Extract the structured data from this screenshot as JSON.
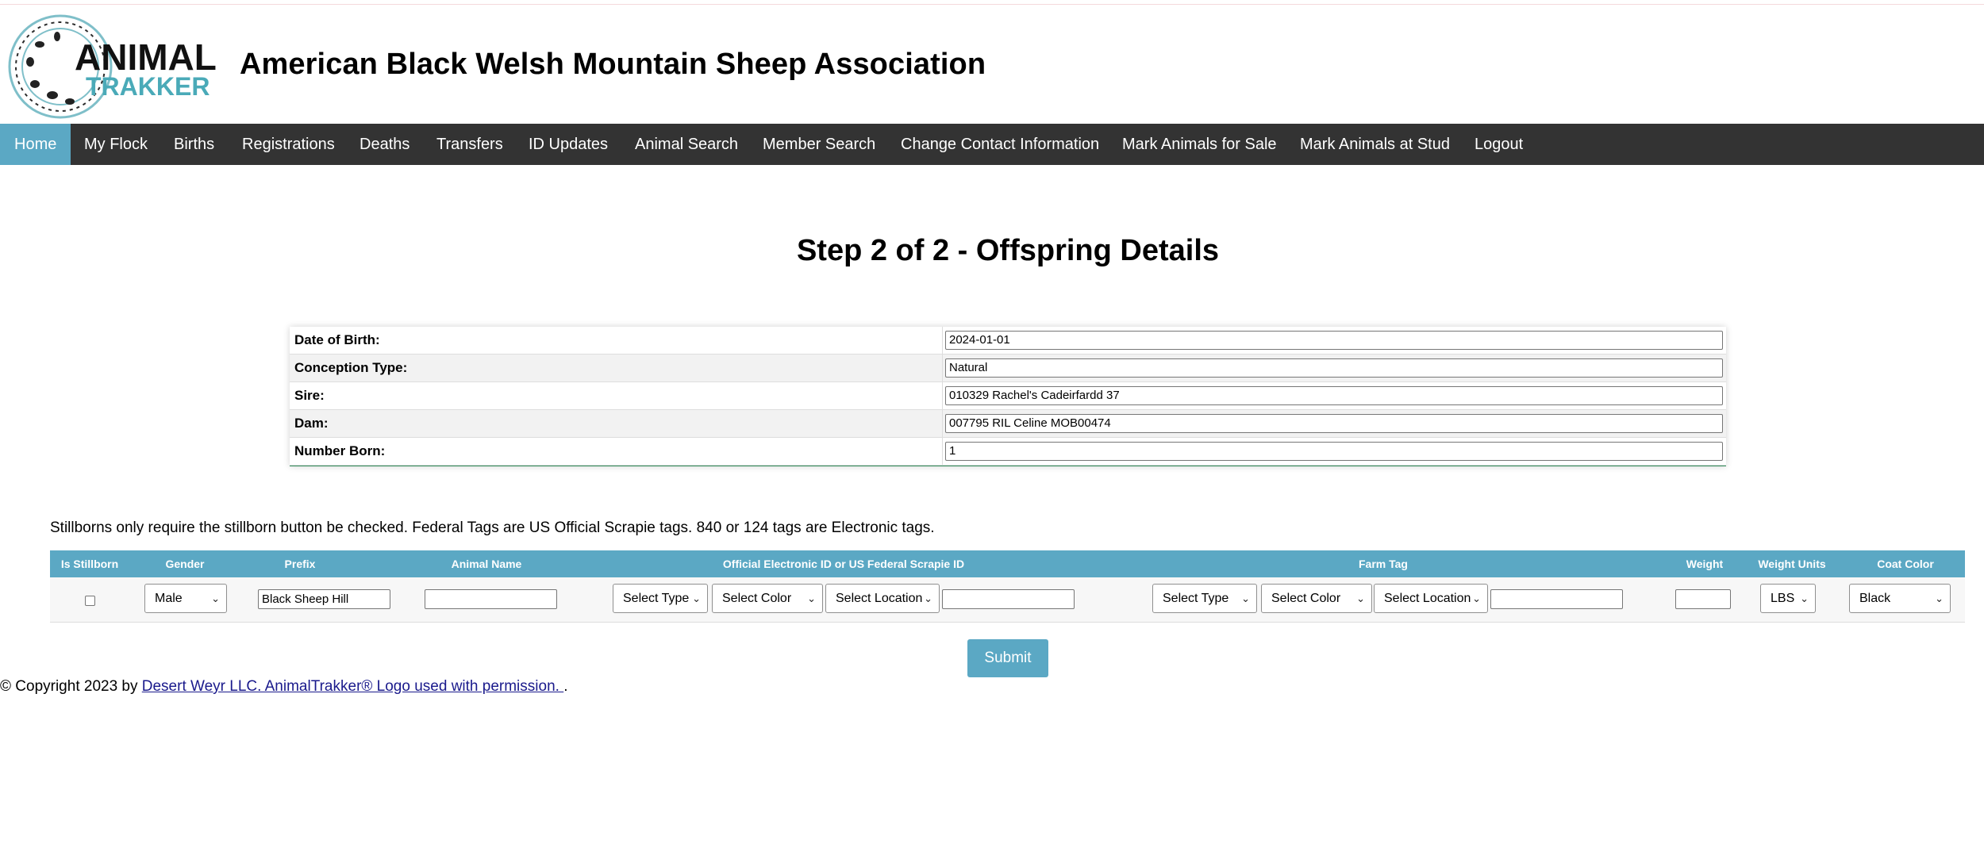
{
  "header": {
    "logo_top": "ANIMAL",
    "logo_bottom": "TRAKKER",
    "title": "American Black Welsh Mountain Sheep Association"
  },
  "nav": {
    "items": [
      {
        "label": "Home",
        "active": true
      },
      {
        "label": "My Flock"
      },
      {
        "label": "Births"
      },
      {
        "label": "Registrations"
      },
      {
        "label": "Deaths"
      },
      {
        "label": "Transfers"
      },
      {
        "label": "ID Updates"
      },
      {
        "label": "Animal Search"
      },
      {
        "label": "Member Search"
      },
      {
        "label": "Change Contact Information"
      },
      {
        "label": "Mark Animals for Sale"
      },
      {
        "label": "Mark Animals at Stud"
      },
      {
        "label": "Logout"
      }
    ]
  },
  "page": {
    "step_title": "Step 2 of 2 - Offspring Details"
  },
  "summary": {
    "rows": [
      {
        "label": "Date of Birth:",
        "value": "2024-01-01"
      },
      {
        "label": "Conception Type:",
        "value": "Natural"
      },
      {
        "label": "Sire:",
        "value": "010329 Rachel's Cadeirfardd 37"
      },
      {
        "label": "Dam:",
        "value": "007795 RIL Celine MOB00474"
      },
      {
        "label": "Number Born:",
        "value": "1"
      }
    ]
  },
  "info_text": "Stillborns only require the stillborn button be checked. Federal Tags are US Official Scrapie tags. 840 or 124 tags are Electronic tags.",
  "offspring": {
    "headers": {
      "is_stillborn": "Is Stillborn",
      "gender": "Gender",
      "prefix": "Prefix",
      "animal_name": "Animal Name",
      "official_id": "Official Electronic ID or US Federal Scrapie ID",
      "farm_tag": "Farm Tag",
      "weight": "Weight",
      "weight_units": "Weight Units",
      "coat_color": "Coat Color"
    },
    "row": {
      "is_stillborn": false,
      "gender": "Male",
      "prefix": "Black Sheep Hill",
      "animal_name": "",
      "official_type": "Select Type",
      "official_color": "Select Color",
      "official_location": "Select Location",
      "official_number": "",
      "farm_type": "Select Type",
      "farm_color": "Select Color",
      "farm_location": "Select Location",
      "farm_number": "",
      "weight": "",
      "weight_units": "LBS",
      "coat_color": "Black"
    }
  },
  "submit_label": "Submit",
  "footer": {
    "prefix": "© Copyright 2023 by ",
    "link": "Desert Weyr LLC. AnimalTrakker® Logo used with permission. ",
    "suffix": "."
  },
  "colors": {
    "nav_bg": "#333333",
    "accent": "#5ba8c4",
    "summary_border": "#2e8b57"
  }
}
